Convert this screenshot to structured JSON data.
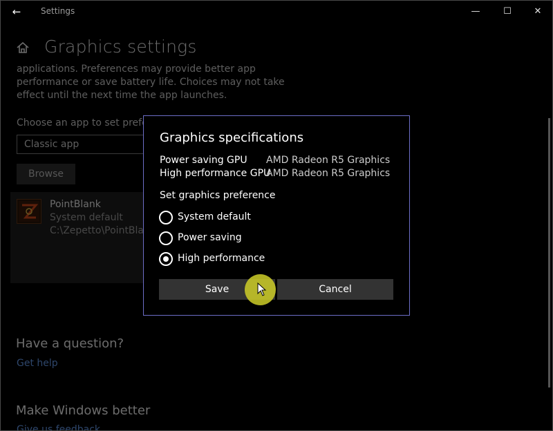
{
  "window": {
    "title": "Settings",
    "back_glyph": "←",
    "min_glyph": "—",
    "max_glyph": "☐",
    "close_glyph": "✕"
  },
  "page": {
    "title": "Graphics settings",
    "description": "applications. Preferences may provide better app performance or save battery life. Choices may not take effect until the next time the app launches.",
    "choose_label": "Choose an app to set preference",
    "app_type_select": "Classic app",
    "browse_label": "Browse"
  },
  "app": {
    "name": "PointBlank",
    "preference": "System default",
    "path": "C:\\Zepetto\\PointBlank"
  },
  "help": {
    "question": "Have a question?",
    "get_help": "Get help",
    "make_better": "Make Windows better",
    "feedback": "Give us feedback"
  },
  "dialog": {
    "title": "Graphics specifications",
    "specs": [
      {
        "label": "Power saving GPU",
        "value": "AMD Radeon R5 Graphics"
      },
      {
        "label": "High performance GPU",
        "value": "AMD Radeon R5 Graphics"
      }
    ],
    "pref_title": "Set graphics preference",
    "options": [
      {
        "label": "System default",
        "checked": false
      },
      {
        "label": "Power saving",
        "checked": false
      },
      {
        "label": "High performance",
        "checked": true
      }
    ],
    "save_label": "Save",
    "cancel_label": "Cancel"
  },
  "colors": {
    "accent": "#6d6ec8",
    "link": "#6ea8ff",
    "cursor_highlight": "#cece28"
  }
}
